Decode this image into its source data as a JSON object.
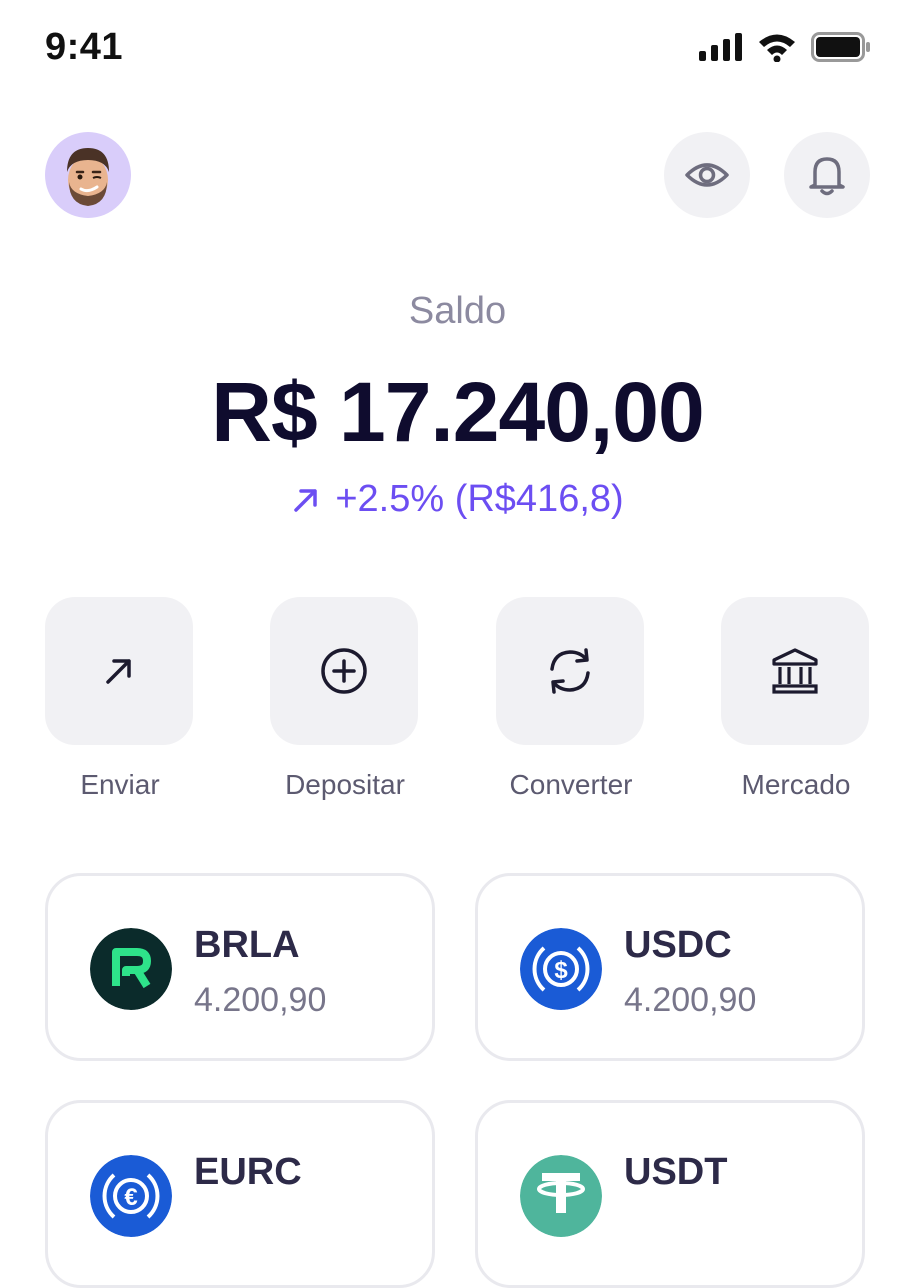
{
  "status_bar": {
    "time": "9:41"
  },
  "balance": {
    "label": "Saldo",
    "value": "R$ 17.240,00",
    "change": "+2.5% (R$416,8)"
  },
  "actions": [
    {
      "label": "Enviar",
      "icon": "arrow-up-right-icon"
    },
    {
      "label": "Depositar",
      "icon": "plus-circle-icon"
    },
    {
      "label": "Converter",
      "icon": "refresh-icon"
    },
    {
      "label": "Mercado",
      "icon": "bank-icon"
    }
  ],
  "assets": [
    {
      "name": "BRLA",
      "amount": "4.200,90",
      "color": "#0b2b2b"
    },
    {
      "name": "USDC",
      "amount": "4.200,90",
      "color": "#1a5bd6"
    },
    {
      "name": "EURC",
      "amount": "",
      "color": "#1a5bd6"
    },
    {
      "name": "USDT",
      "amount": "",
      "color": "#4fb59c"
    }
  ],
  "colors": {
    "accent": "#6c4ef2",
    "text": "#0f0c2e",
    "tile": "#f1f1f4"
  }
}
